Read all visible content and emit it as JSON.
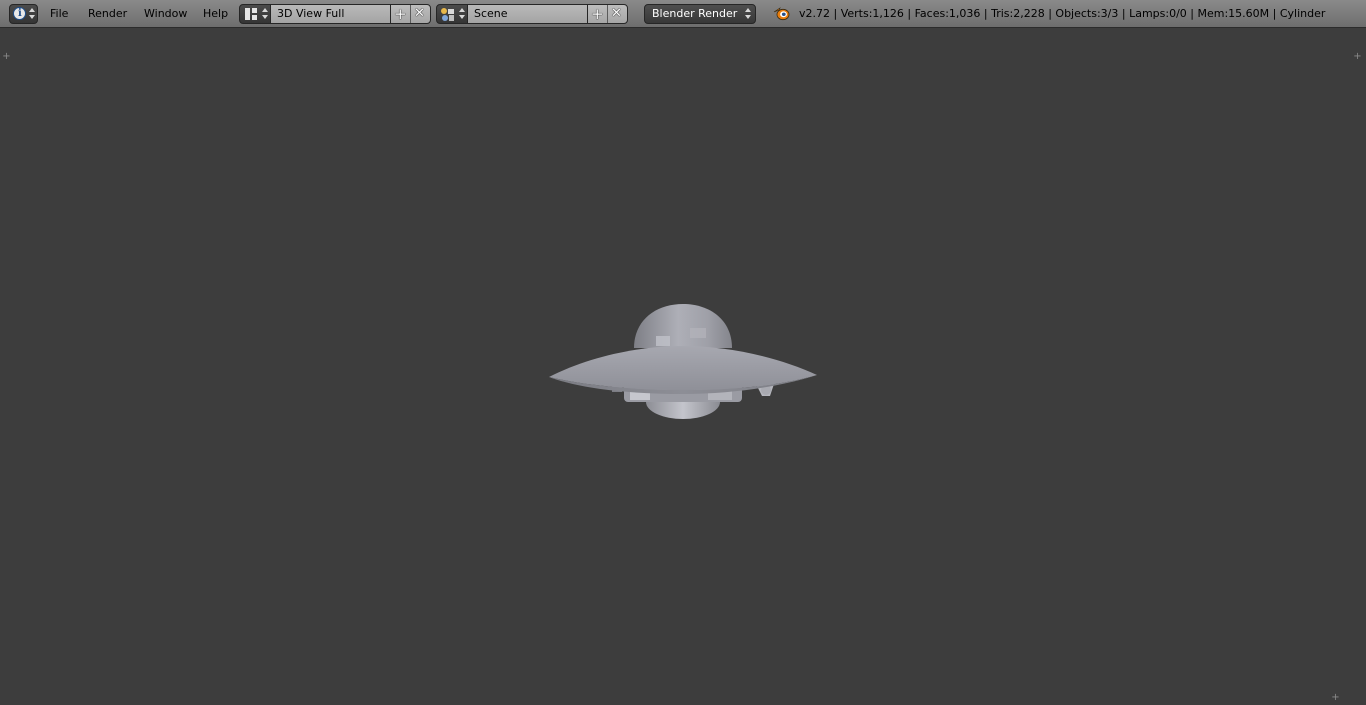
{
  "header": {
    "info_icon": "info-icon",
    "menus": [
      {
        "label": "File"
      },
      {
        "label": "Render"
      },
      {
        "label": "Window"
      },
      {
        "label": "Help"
      }
    ],
    "screen_layout": {
      "icon": "layout-grid-icon",
      "value": "3D View Full"
    },
    "scene": {
      "icon": "scene-icon",
      "value": "Scene"
    },
    "render_engine": {
      "value": "Blender Render"
    },
    "blender_logo_icon": "blender-logo-icon",
    "stats": "v2.72 | Verts:1,126 | Faces:1,036 | Tris:2,228 | Objects:3/3 | Lamps:0/0 | Mem:15.60M | Cylinder"
  },
  "viewport": {
    "background": "#3d3d3d",
    "object_color": "#9a9ba3",
    "corner_icons": [
      "plus-icon",
      "plus-icon",
      "plus-icon"
    ]
  }
}
